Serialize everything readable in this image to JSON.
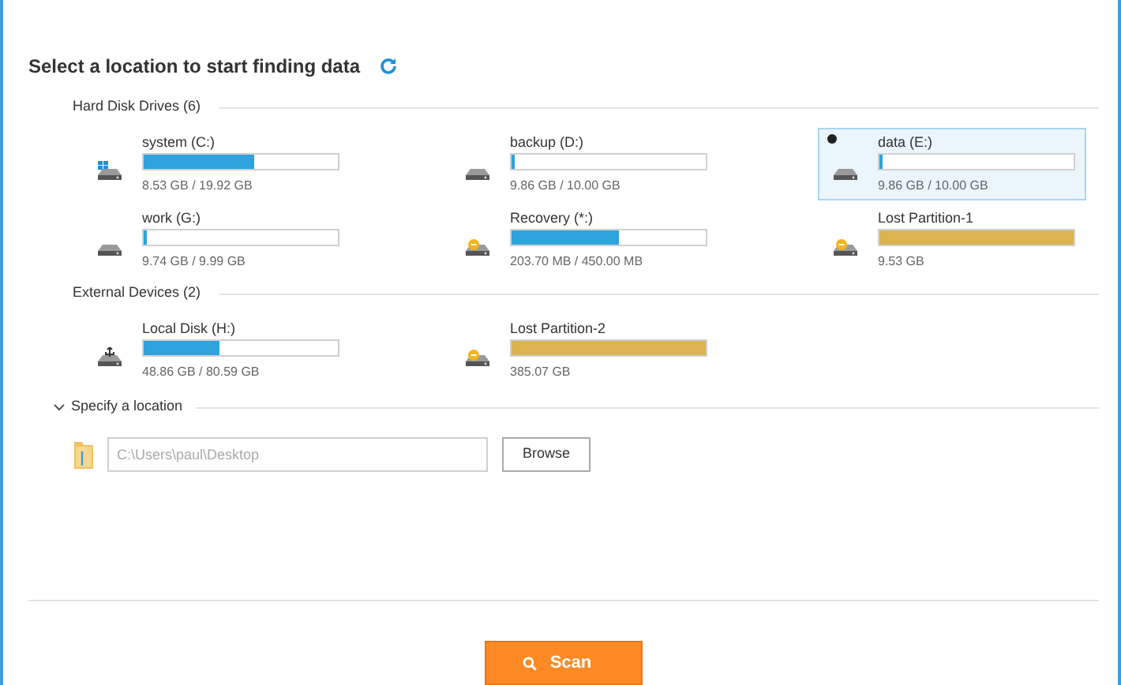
{
  "heading": "Select a location to start finding data",
  "groups": [
    {
      "title": "Hard Disk Drives (6)",
      "drives": [
        {
          "name": "system (C:)",
          "kind": "windows",
          "level": 0.57,
          "color": "#2ea3dc",
          "size": "8.53 GB / 19.92 GB",
          "selected": false
        },
        {
          "name": "backup (D:)",
          "kind": "disk",
          "level": 0.01,
          "color": "#2ea3dc",
          "size": "9.86 GB / 10.00 GB",
          "selected": false
        },
        {
          "name": "data (E:)",
          "kind": "disk",
          "level": 0.005,
          "color": "#2ea3dc",
          "size": "9.86 GB / 10.00 GB",
          "selected": true
        },
        {
          "name": "work (G:)",
          "kind": "disk",
          "level": 0.02,
          "color": "#2ea3dc",
          "size": "9.74 GB / 9.99 GB",
          "selected": false
        },
        {
          "name": "Recovery (*:)",
          "kind": "lost",
          "level": 0.55,
          "color": "#2ea3dc",
          "size": "203.70 MB / 450.00 MB",
          "selected": false
        },
        {
          "name": "Lost Partition-1",
          "kind": "lost",
          "level": 1,
          "color": "#d9b451",
          "size": "9.53 GB",
          "selected": false
        }
      ]
    },
    {
      "title": "External Devices (2)",
      "drives": [
        {
          "name": "Local Disk (H:)",
          "kind": "usb",
          "level": 0.39,
          "color": "#2ea3dc",
          "size": "48.86 GB / 80.59 GB",
          "selected": false
        },
        {
          "name": "Lost Partition-2",
          "kind": "lost",
          "level": 1,
          "color": "#d9b451",
          "size": "385.07 GB",
          "selected": false
        }
      ]
    }
  ],
  "specify": {
    "title": "Specify a location",
    "expanded": true,
    "placeholder": "C:\\Users\\paul\\Desktop",
    "browse": "Browse"
  },
  "scan": "Scan"
}
